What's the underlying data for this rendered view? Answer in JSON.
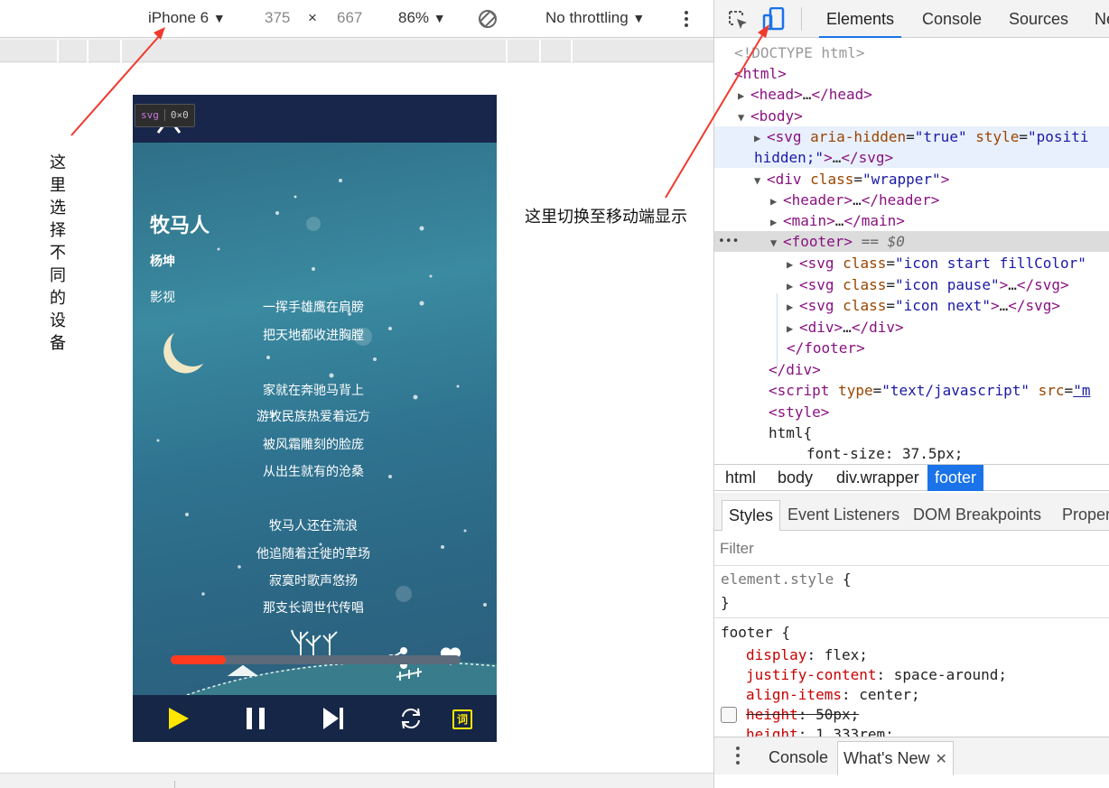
{
  "device_toolbar": {
    "device": "iPhone 6",
    "width": "375",
    "times": "×",
    "height": "667",
    "zoom": "86%",
    "throttling": "No throttling",
    "dropdown_glyph": "▼"
  },
  "annotations": {
    "device_select_note": "这里选择不同的设备",
    "mobile_toggle_note": "这里切换至移动端显示"
  },
  "phone": {
    "inspector_tip": {
      "tag": "svg",
      "size": "0×0"
    },
    "song_title": "牧马人",
    "artist": "杨坤",
    "category": "影视",
    "lyrics": [
      "一挥手雄鹰在肩膀",
      "把天地都收进胸膛",
      "",
      "家就在奔驰马背上",
      "游牧民族热爱着远方",
      "被风霜雕刻的脸庞",
      "从出生就有的沧桑",
      "",
      "牧马人还在流浪",
      "他追随着迁徙的草场",
      "寂寞时歌声悠扬",
      "那支长调世代传唱"
    ],
    "progress": 0.19,
    "lyric_button": "词",
    "colors": {
      "progress": "#ff3b1f",
      "play": "#ffe600",
      "lyric_button": "#ffe600"
    }
  },
  "devtools": {
    "tabs": [
      "Elements",
      "Console",
      "Sources",
      "Ne"
    ],
    "active_tab": "Elements",
    "breadcrumbs": [
      "html",
      "body",
      "div.wrapper",
      "footer"
    ],
    "styles_tabs": [
      "Styles",
      "Event Listeners",
      "DOM Breakpoints",
      "Proper"
    ],
    "filter_placeholder": "Filter",
    "drawer_tabs": [
      "Console",
      "What's New"
    ],
    "accent": "#1a73e8"
  }
}
